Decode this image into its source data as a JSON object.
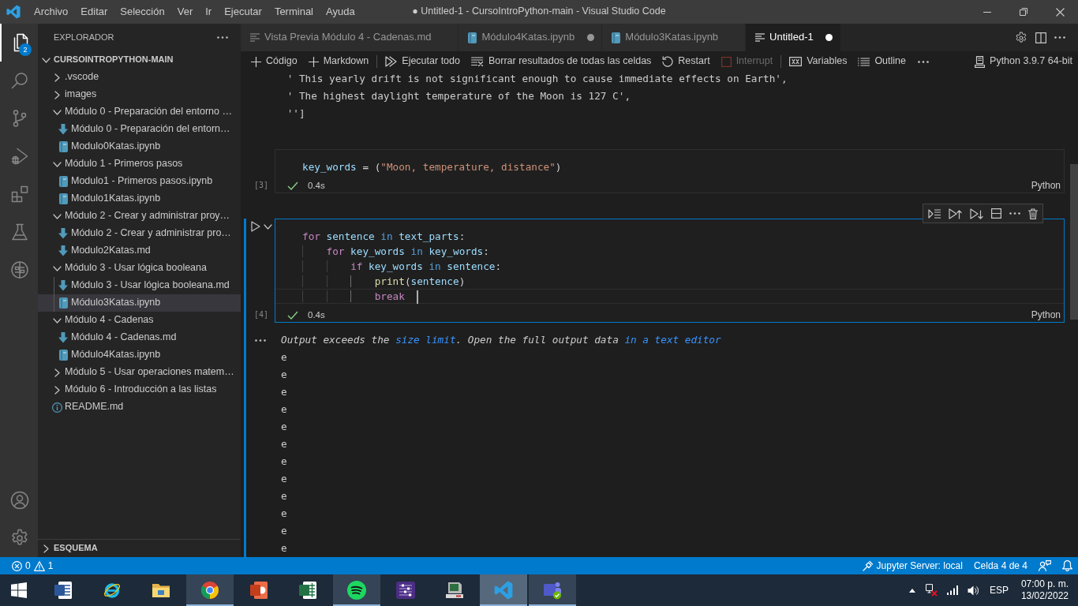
{
  "window": {
    "title": "● Untitled-1 - CursoIntroPython-main - Visual Studio Code"
  },
  "menu": [
    "Archivo",
    "Editar",
    "Selección",
    "Ver",
    "Ir",
    "Ejecutar",
    "Terminal",
    "Ayuda"
  ],
  "activity_bar": {
    "items": [
      {
        "kind": "explorer",
        "selected": true,
        "badge": "2"
      },
      {
        "kind": "search",
        "selected": false
      },
      {
        "kind": "source-control",
        "selected": false
      },
      {
        "kind": "run-debug",
        "selected": false
      },
      {
        "kind": "extensions",
        "selected": false
      },
      {
        "kind": "testing",
        "selected": false
      },
      {
        "kind": "remote",
        "selected": false
      }
    ],
    "bottom": [
      {
        "kind": "account"
      },
      {
        "kind": "settings"
      }
    ]
  },
  "sidebar": {
    "title": "EXPLORADOR",
    "root": {
      "label": "CURSOINTROPYTHON-MAIN",
      "expanded": true
    },
    "tree": [
      {
        "label": ".vscode",
        "kind": "folder",
        "expanded": false,
        "selected": false
      },
      {
        "label": "images",
        "kind": "folder",
        "expanded": false,
        "selected": false
      },
      {
        "label": "Módulo 0 - Preparación del entorno …",
        "kind": "folder",
        "expanded": true,
        "selected": false,
        "children": [
          {
            "label": "Módulo 0 - Preparación del entorn…",
            "kind": "markdown",
            "selected": false
          },
          {
            "label": "Modulo0Katas.ipynb",
            "kind": "notebook",
            "selected": false
          }
        ]
      },
      {
        "label": "Módulo 1 - Primeros pasos",
        "kind": "folder",
        "expanded": true,
        "selected": false,
        "children": [
          {
            "label": "Modulo1 - Primeros pasos.ipynb",
            "kind": "notebook",
            "selected": false
          },
          {
            "label": "Modulo1Katas.ipynb",
            "kind": "notebook",
            "selected": false
          }
        ]
      },
      {
        "label": "Módulo 2 - Crear y administrar proy…",
        "kind": "folder",
        "expanded": true,
        "selected": false,
        "children": [
          {
            "label": "Módulo 2 - Crear y administrar pro…",
            "kind": "markdown",
            "selected": false
          },
          {
            "label": "Modulo2Katas.md",
            "kind": "markdown",
            "selected": false
          }
        ]
      },
      {
        "label": "Módulo 3 - Usar lógica booleana",
        "kind": "folder",
        "expanded": true,
        "selected": false,
        "children": [
          {
            "label": "Módulo 3 - Usar lógica booleana.md",
            "kind": "markdown",
            "selected": false
          },
          {
            "label": "Módulo3Katas.ipynb",
            "kind": "notebook",
            "selected": true
          }
        ]
      },
      {
        "label": "Módulo 4 - Cadenas",
        "kind": "folder",
        "expanded": true,
        "selected": false,
        "children": [
          {
            "label": "Módulo 4 - Cadenas.md",
            "kind": "markdown",
            "selected": false
          },
          {
            "label": "Módulo4Katas.ipynb",
            "kind": "notebook",
            "selected": false
          }
        ]
      },
      {
        "label": "Módulo 5 - Usar operaciones matem…",
        "kind": "folder",
        "expanded": false,
        "selected": false
      },
      {
        "label": "Módulo 6 - Introducción a las listas",
        "kind": "folder",
        "expanded": false,
        "selected": false
      },
      {
        "label": "README.md",
        "kind": "info",
        "selected": false
      }
    ],
    "outline": {
      "label": "ESQUEMA",
      "expanded": false
    }
  },
  "tabs": [
    {
      "label": "Vista Previa Módulo 4 - Cadenas.md",
      "kind": "document",
      "selected": false,
      "dirty": false
    },
    {
      "label": "Módulo4Katas.ipynb",
      "kind": "notebook",
      "selected": false,
      "dirty": true
    },
    {
      "label": "Módulo3Katas.ipynb",
      "kind": "notebook",
      "selected": false,
      "dirty": false
    },
    {
      "label": "Untitled-1",
      "kind": "document",
      "selected": true,
      "dirty": true
    }
  ],
  "notebook_toolbar": {
    "groups": [
      [
        {
          "kind": "add",
          "label": "Código",
          "disabled": false
        },
        {
          "kind": "add",
          "label": "Markdown",
          "disabled": false
        }
      ],
      [
        {
          "kind": "run-all",
          "label": "Ejecutar todo",
          "disabled": false
        },
        {
          "kind": "clear",
          "label": "Borrar resultados de todas las celdas",
          "disabled": false
        },
        {
          "kind": "restart",
          "label": "Restart",
          "disabled": false
        },
        {
          "kind": "interrupt",
          "label": "Interrupt",
          "disabled": true
        }
      ],
      [
        {
          "kind": "variables",
          "label": "Variables",
          "disabled": false
        },
        {
          "kind": "outline",
          "label": "Outline",
          "disabled": false
        }
      ]
    ],
    "kernel": "Python 3.9.7 64-bit"
  },
  "notebook": {
    "prior_output": [
      " ' This yearly drift is not significant enough to cause immediate effects on Earth',",
      " ' The highest daylight temperature of the Moon is 127 C',",
      " '']"
    ],
    "cells": [
      {
        "count": "[3]",
        "focused": false,
        "lines": [
          {
            "cursor": false,
            "tokens": [
              {
                "text": "key_words",
                "kind": "variable"
              },
              {
                "text": " = (",
                "kind": "plain"
              },
              {
                "text": "\"Moon, temperature, distance\"",
                "kind": "string"
              },
              {
                "text": ")",
                "kind": "plain"
              }
            ]
          }
        ],
        "success": true,
        "duration": "0.4s",
        "language": "Python"
      },
      {
        "count": "[4]",
        "focused": true,
        "lines": [
          {
            "cursor": false,
            "tokens": [
              {
                "text": "for",
                "kind": "keyword"
              },
              {
                "text": " sentence",
                "kind": "variable"
              },
              {
                "text": " in",
                "kind": "operator"
              },
              {
                "text": " text_parts",
                "kind": "variable"
              },
              {
                "text": ":",
                "kind": "plain"
              }
            ]
          },
          {
            "cursor": false,
            "tokens": [
              {
                "text": "    for",
                "kind": "keyword"
              },
              {
                "text": " key_words",
                "kind": "variable"
              },
              {
                "text": " in",
                "kind": "operator"
              },
              {
                "text": " key_words",
                "kind": "variable"
              },
              {
                "text": ":",
                "kind": "plain"
              }
            ]
          },
          {
            "cursor": false,
            "tokens": [
              {
                "text": "        if",
                "kind": "keyword"
              },
              {
                "text": " key_words",
                "kind": "variable"
              },
              {
                "text": " in",
                "kind": "operator"
              },
              {
                "text": " sentence",
                "kind": "variable"
              },
              {
                "text": ":",
                "kind": "plain"
              }
            ]
          },
          {
            "cursor": false,
            "tokens": [
              {
                "text": "            print",
                "kind": "function"
              },
              {
                "text": "(",
                "kind": "plain"
              },
              {
                "text": "sentence",
                "kind": "variable"
              },
              {
                "text": ")",
                "kind": "plain"
              }
            ]
          },
          {
            "cursor": true,
            "tokens": [
              {
                "text": "            break",
                "kind": "keyword"
              }
            ]
          }
        ],
        "success": true,
        "duration": "0.4s",
        "language": "Python",
        "output": {
          "notice": [
            {
              "text": "Output exceeds the ",
              "kind": "text"
            },
            {
              "text": "size limit",
              "kind": "link"
            },
            {
              "text": ". Open the full output data ",
              "kind": "text"
            },
            {
              "text": "in a text editor",
              "kind": "link"
            }
          ],
          "lines": [
            "e",
            "e",
            "e",
            "e",
            "e",
            "e",
            "e",
            "e",
            "e",
            "e",
            "e",
            "e"
          ]
        }
      }
    ]
  },
  "status_bar": {
    "errors": "0",
    "warnings": "1",
    "items": [
      {
        "kind": "server",
        "label": "Jupyter Server: local"
      },
      {
        "kind": "text",
        "label": "Celda 4 de 4"
      },
      {
        "kind": "feedback"
      },
      {
        "kind": "notifications"
      }
    ]
  },
  "taskbar": {
    "apps": [
      {
        "kind": "start",
        "running": false,
        "selected": false
      },
      {
        "kind": "document",
        "running": false,
        "selected": false
      },
      {
        "kind": "globe",
        "running": false,
        "selected": false
      },
      {
        "kind": "folder",
        "running": false,
        "selected": false
      },
      {
        "kind": "ring",
        "running": true,
        "selected": false
      },
      {
        "kind": "presentation",
        "running": false,
        "selected": false
      },
      {
        "kind": "spreadsheet",
        "running": false,
        "selected": false
      },
      {
        "kind": "waves",
        "running": true,
        "selected": false
      },
      {
        "kind": "sliders",
        "running": false,
        "selected": false
      },
      {
        "kind": "computer",
        "running": false,
        "selected": false
      },
      {
        "kind": "editor",
        "running": true,
        "selected": true
      },
      {
        "kind": "people",
        "running": true,
        "selected": false
      }
    ],
    "tray": {
      "language": "ESP",
      "time": "07:00 p. m.",
      "date": "13/02/2022"
    }
  }
}
